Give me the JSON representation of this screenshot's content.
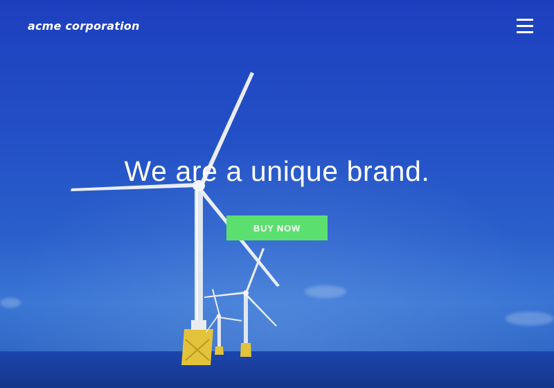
{
  "brand": {
    "name": "acme corporation"
  },
  "nav": {
    "menu_icon": "hamburger-menu-icon"
  },
  "hero": {
    "headline": "We are a unique brand.",
    "cta_label": "BUY NOW",
    "background": "offshore wind turbines over the sea"
  },
  "colors": {
    "sky": "#2350c6",
    "sea": "#1a3f9f",
    "cta": "#5be06f",
    "text": "#ffffff",
    "turbine_base": "#e0c43a"
  }
}
